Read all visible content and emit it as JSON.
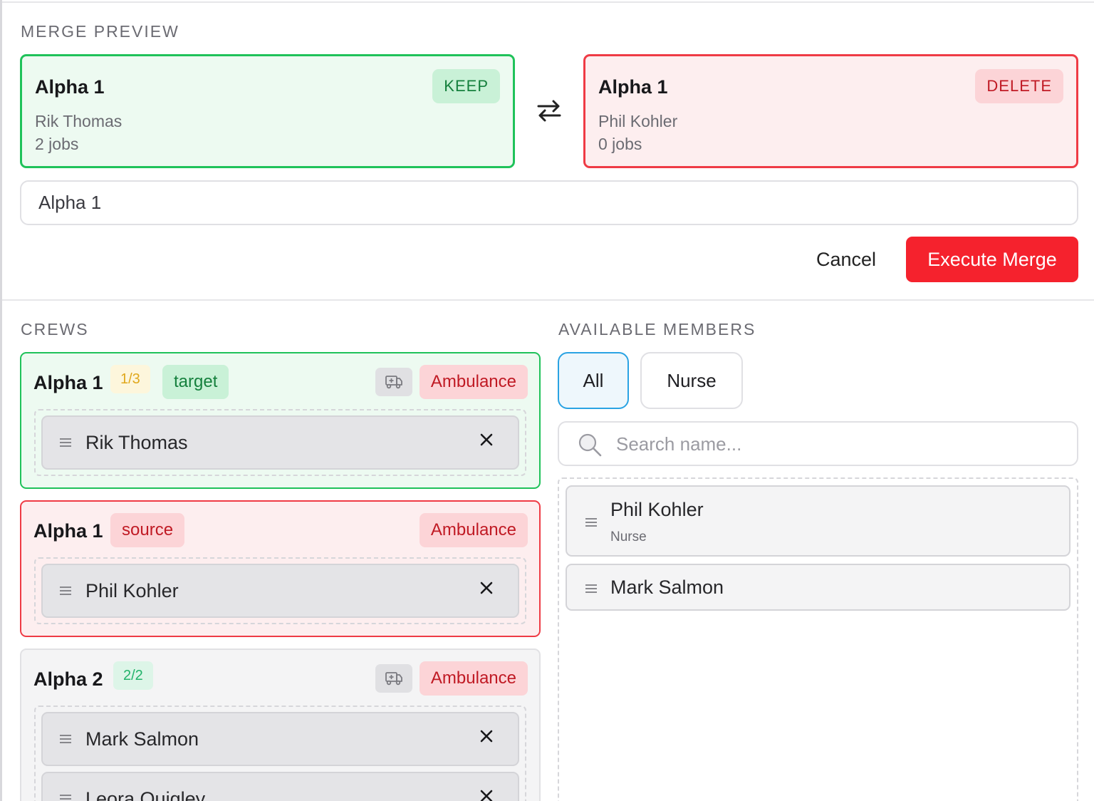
{
  "merge_preview": {
    "section_label": "MERGE PREVIEW",
    "keep_card": {
      "title": "Alpha 1",
      "badge": "KEEP",
      "member": "Rik Thomas",
      "jobs": "2 jobs"
    },
    "delete_card": {
      "title": "Alpha 1",
      "badge": "DELETE",
      "member": "Phil Kohler",
      "jobs": "0 jobs"
    },
    "swap_icon": "swap-arrows-icon",
    "name_input_value": "Alpha 1",
    "cancel_label": "Cancel",
    "execute_label": "Execute Merge"
  },
  "crews": {
    "section_label": "CREWS",
    "items": [
      {
        "name": "Alpha 1",
        "count": "1/3",
        "role": "target",
        "vehicle_icon": "ambulance-icon",
        "vehicle_type": "Ambulance",
        "members": [
          "Rik Thomas"
        ]
      },
      {
        "name": "Alpha 1",
        "role": "source",
        "vehicle_type": "Ambulance",
        "members": [
          "Phil Kohler"
        ]
      },
      {
        "name": "Alpha 2",
        "count": "2/2",
        "vehicle_icon": "ambulance-icon",
        "vehicle_type": "Ambulance",
        "members": [
          "Mark Salmon",
          "Leora Quigley"
        ]
      }
    ]
  },
  "available_members": {
    "section_label": "AVAILABLE MEMBERS",
    "filters": [
      "All",
      "Nurse"
    ],
    "selected_filter": "All",
    "search_placeholder": "Search name...",
    "items": [
      {
        "name": "Phil Kohler",
        "role": "Nurse"
      },
      {
        "name": "Mark Salmon"
      }
    ]
  },
  "colors": {
    "keep_green": "#1fc25a",
    "delete_red": "#ef3b45",
    "primary_red": "#f5222d",
    "filter_active_blue": "#2aa3e3"
  }
}
